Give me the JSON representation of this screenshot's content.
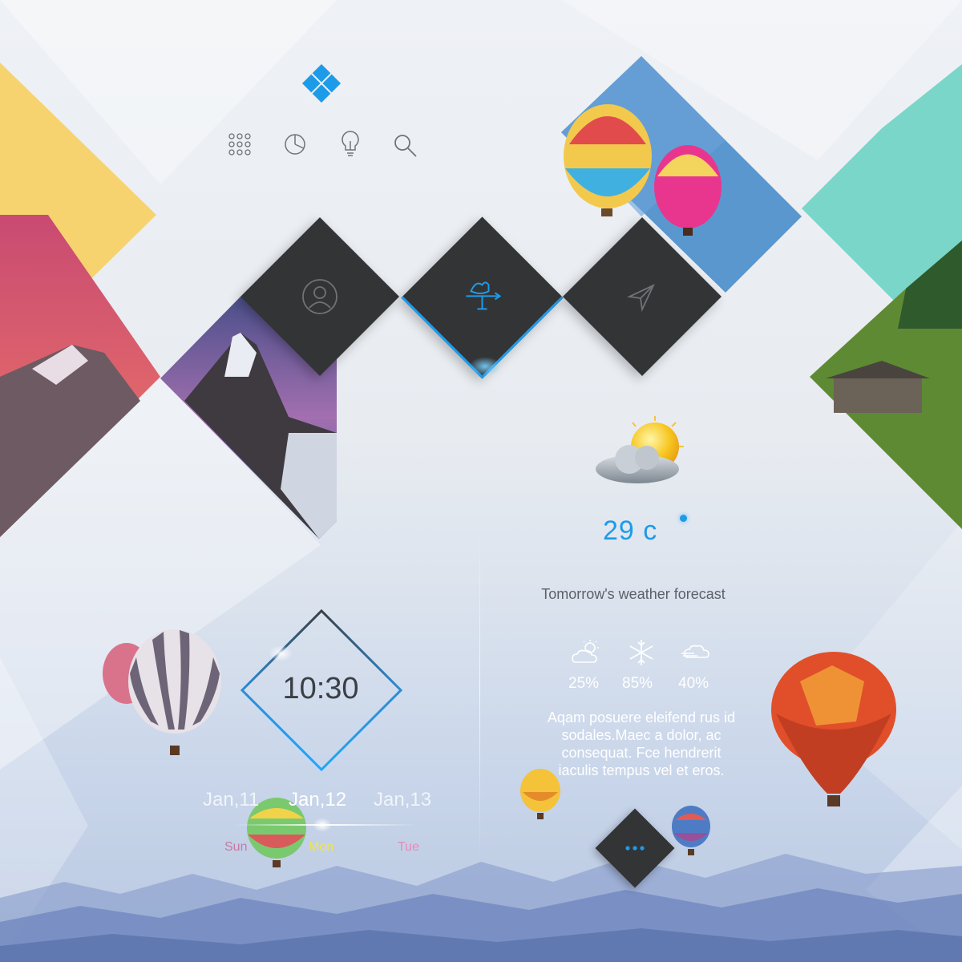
{
  "header": {
    "logo": "windows-logo-icon",
    "toolbar_icons": [
      "apps-grid-icon",
      "pie-chart-icon",
      "lightbulb-icon",
      "search-icon"
    ]
  },
  "tiles": [
    {
      "name": "profile",
      "icon": "user-icon"
    },
    {
      "name": "weather-vane",
      "icon": "weather-vane-icon",
      "active": true
    },
    {
      "name": "send",
      "icon": "send-icon"
    }
  ],
  "weather": {
    "temperature": "29 c",
    "forecast_title": "Tomorrow's weather forecast",
    "forecast": [
      {
        "icon": "sun-cloud-icon",
        "value": "25%"
      },
      {
        "icon": "snowflake-icon",
        "value": "85%"
      },
      {
        "icon": "wind-cloud-icon",
        "value": "40%"
      }
    ],
    "description": "Aqam posuere eleifend rus id sodales.Maec a dolor, ac consequat. Fce hendrerit iaculis tempus vel et eros."
  },
  "clock": {
    "time": "10:30",
    "dates": [
      "Jan,11",
      "Jan,12",
      "Jan,13"
    ],
    "days": [
      "Sun",
      "Mon",
      "Tue"
    ],
    "selected_index": 1
  },
  "more_button": {
    "icon": "more-dots-icon"
  },
  "colors": {
    "accent": "#1e9be8",
    "yellow": "#f7d36f",
    "teal": "#7ad6c8",
    "tile": "#333436",
    "sun_day": "#c77aa0",
    "mon_day": "#f1e34a",
    "tue_day": "#e68ab8"
  }
}
